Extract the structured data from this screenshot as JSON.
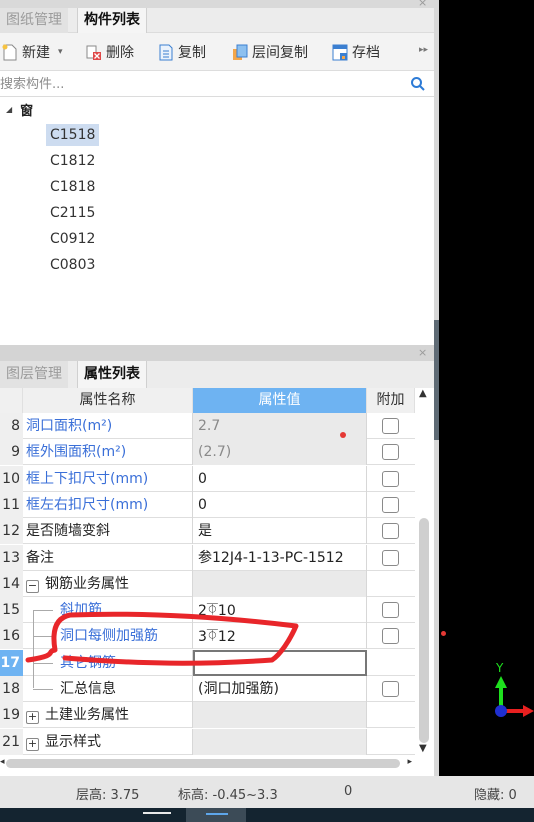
{
  "top_panel": {
    "tabs": [
      {
        "label": "图纸管理",
        "active": false
      },
      {
        "label": "构件列表",
        "active": true
      }
    ],
    "toolbar": {
      "new_label": "新建",
      "delete_label": "删除",
      "copy_label": "复制",
      "floor_copy_label": "层间复制",
      "archive_label": "存档",
      "more_icon": "double-chevron-right"
    },
    "search": {
      "placeholder": "搜索构件...",
      "value": ""
    },
    "tree": {
      "root_label": "窗",
      "items": [
        "C1518",
        "C1812",
        "C1818",
        "C2115",
        "C0912",
        "C0803"
      ],
      "selected": "C1518"
    }
  },
  "bottom_panel": {
    "tabs": [
      {
        "label": "图层管理",
        "active": false
      },
      {
        "label": "属性列表",
        "active": true
      }
    ],
    "columns": {
      "name": "属性名称",
      "value": "属性值",
      "extra": "附加"
    },
    "rows": [
      {
        "num": "8",
        "name": "洞口面积(m²)",
        "value": "2.7",
        "blue": true,
        "disabled": true,
        "checkbox": true
      },
      {
        "num": "9",
        "name": "框外围面积(m²)",
        "value": "(2.7)",
        "blue": true,
        "disabled": true,
        "checkbox": true
      },
      {
        "num": "10",
        "name": "框上下扣尺寸(mm)",
        "value": "0",
        "blue": true,
        "checkbox": true
      },
      {
        "num": "11",
        "name": "框左右扣尺寸(mm)",
        "value": "0",
        "blue": true,
        "checkbox": true
      },
      {
        "num": "12",
        "name": "是否随墙变斜",
        "value": "是",
        "checkbox": true
      },
      {
        "num": "13",
        "name": "备注",
        "value": "参12J4-1-13-PC-1512",
        "checkbox": true
      },
      {
        "num": "14",
        "name": "钢筋业务属性",
        "value": "",
        "group": "collapse",
        "disabled": true
      },
      {
        "num": "15",
        "name": "斜加筋",
        "value": "2⏁10",
        "blue": true,
        "child": true,
        "checkbox": true
      },
      {
        "num": "16",
        "name": "洞口每侧加强筋",
        "value": "3⏁12",
        "blue": true,
        "child": true,
        "checkbox": true
      },
      {
        "num": "17",
        "name": "其它钢筋",
        "value": "",
        "blue": true,
        "child": true,
        "current": true,
        "editing": true
      },
      {
        "num": "18",
        "name": "汇总信息",
        "value": "(洞口加强筋)",
        "child": true,
        "checkbox": true
      },
      {
        "num": "19",
        "name": "土建业务属性",
        "value": "",
        "group": "expand",
        "disabled": true
      },
      {
        "num": "21",
        "name": "显示样式",
        "value": "",
        "group": "expand",
        "disabled": true
      }
    ]
  },
  "status_bar": {
    "floor_height": "层高:  3.75",
    "elevation": "标高: -0.45~3.3",
    "count": "0",
    "hidden": "隐藏:  0"
  },
  "canvas": {
    "axis_y_label": "Y",
    "colors": {
      "y_axis": "#1ee01e",
      "x_axis": "#e82020",
      "origin": "#1f2fd0",
      "annotation": "#e8262a"
    }
  }
}
